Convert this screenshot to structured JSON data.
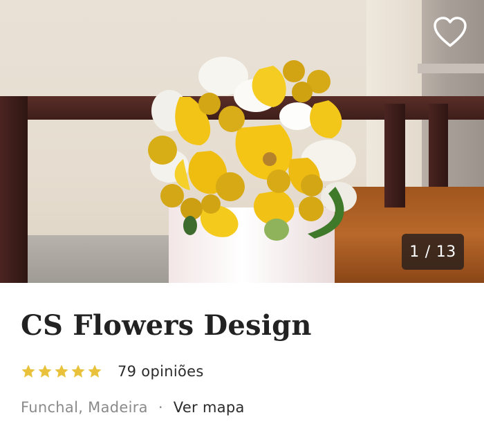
{
  "gallery": {
    "current": "1",
    "total": "13",
    "separator": "/"
  },
  "vendor": {
    "name": "CS Flowers Design",
    "rating_stars": 5,
    "reviews_label": "79 opiniões",
    "location": "Funchal, Madeira",
    "location_separator": "·",
    "map_link": "Ver mapa"
  },
  "icons": {
    "favorite": "heart-outline-icon",
    "rating": "star-icon"
  },
  "colors": {
    "star": "#e9c13b",
    "title": "#222222",
    "muted_text": "#8a8a8a",
    "counter_bg": "#281e1c"
  }
}
